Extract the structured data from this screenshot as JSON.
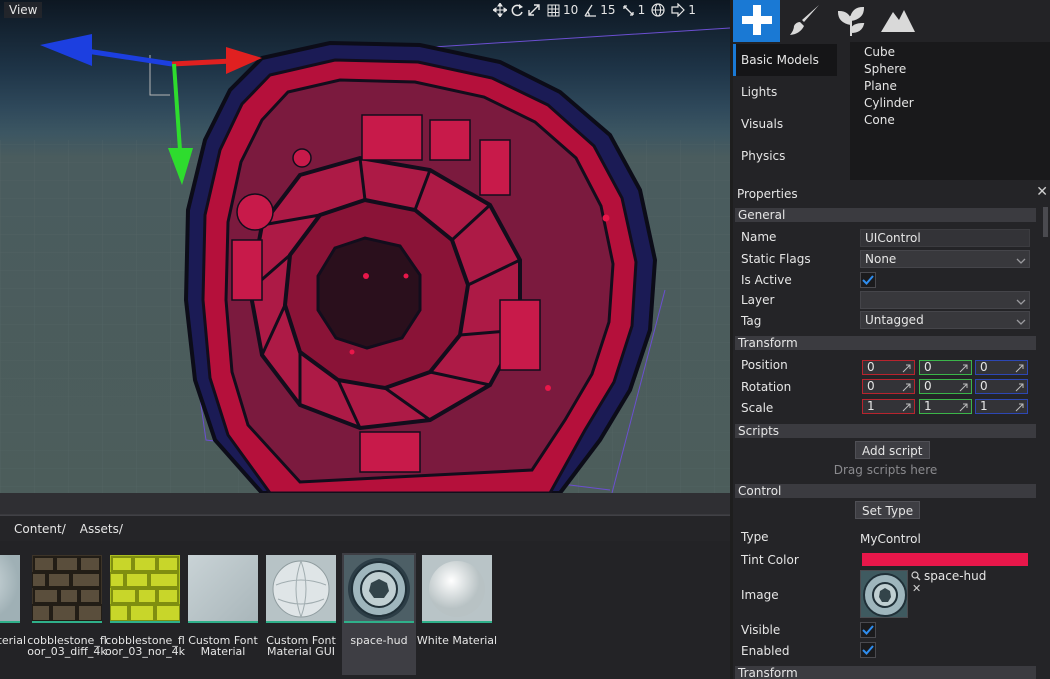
{
  "viewport": {
    "title": "View",
    "toolbar": {
      "grid_size": "10",
      "rotate_snap": "15",
      "scale_snap": "1",
      "camera_speed": "1"
    }
  },
  "toolbox": {
    "tabs": [
      {
        "icon": "plus-icon",
        "active": true
      },
      {
        "icon": "brush-icon",
        "active": false
      },
      {
        "icon": "leaves-icon",
        "active": false
      },
      {
        "icon": "mountain-icon",
        "active": false
      }
    ],
    "categories": [
      "Basic Models",
      "Lights",
      "Visuals",
      "Physics"
    ],
    "active_category": "Basic Models",
    "models": [
      "Cube",
      "Sphere",
      "Plane",
      "Cylinder",
      "Cone"
    ]
  },
  "properties": {
    "title": "Properties",
    "general": {
      "header": "General",
      "name_label": "Name",
      "name_value": "UIControl",
      "static_flags_label": "Static Flags",
      "static_flags_value": "None",
      "is_active_label": "Is Active",
      "is_active": true,
      "layer_label": "Layer",
      "layer_value": "",
      "tag_label": "Tag",
      "tag_value": "Untagged"
    },
    "transform": {
      "header": "Transform",
      "position_label": "Position",
      "position": [
        "0",
        "0",
        "0"
      ],
      "rotation_label": "Rotation",
      "rotation": [
        "0",
        "0",
        "0"
      ],
      "scale_label": "Scale",
      "scale": [
        "1",
        "1",
        "1"
      ]
    },
    "scripts": {
      "header": "Scripts",
      "add_button": "Add script",
      "hint": "Drag scripts here"
    },
    "control": {
      "header": "Control",
      "set_type_button": "Set Type",
      "type_label": "Type",
      "type_value": "MyControl",
      "tint_label": "Tint Color",
      "tint_color": "#e8174a",
      "image_label": "Image",
      "image_value": "space-hud",
      "visible_label": "Visible",
      "visible": true,
      "enabled_label": "Enabled",
      "enabled": true
    },
    "transform2_header": "Transform"
  },
  "content": {
    "breadcrumbs": [
      "Content/",
      "Assets/"
    ],
    "assets": [
      {
        "name": "aterial",
        "kind": "material-white"
      },
      {
        "name": "cobblestone_floor_03_diff_4k",
        "kind": "cobble-diff"
      },
      {
        "name": "cobblestone_floor_03_nor_4k",
        "kind": "cobble-nor"
      },
      {
        "name": "Custom Font Material",
        "kind": "font-material"
      },
      {
        "name": "Custom Font Material GUI",
        "kind": "font-material-gui"
      },
      {
        "name": "space-hud",
        "kind": "space-hud",
        "selected": true
      },
      {
        "name": "White Material",
        "kind": "white-material"
      }
    ]
  },
  "colors": {
    "accent": "#1a79d4",
    "hud_red": "#c8143c",
    "axis_x": "#e02020",
    "axis_y": "#2edc2e",
    "axis_z": "#1c3fe0"
  }
}
